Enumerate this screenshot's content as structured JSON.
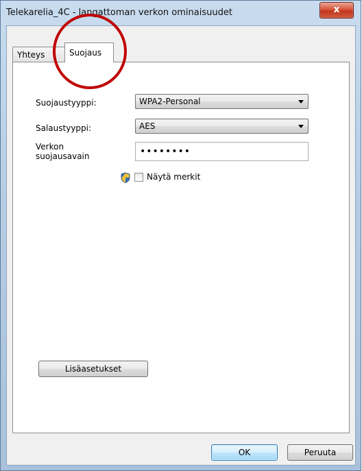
{
  "window": {
    "title": "Telekarelia_4C - langattoman verkon ominaisuudet",
    "close_label": "x"
  },
  "tabs": [
    {
      "label": "Yhteys",
      "active": false
    },
    {
      "label": "Suojaus",
      "active": true
    }
  ],
  "security": {
    "security_type_label": "Suojaustyyppi:",
    "security_type_value": "WPA2-Personal",
    "encryption_type_label": "Salaustyyppi:",
    "encryption_type_value": "AES",
    "key_label_line1": "Verkon",
    "key_label_line2": "suojausavain",
    "key_value": "••••••••",
    "show_chars_label": "Näytä merkit",
    "show_chars_checked": false
  },
  "buttons": {
    "advanced_label": "Lisäasetukset",
    "ok_label": "OK",
    "cancel_label": "Peruuta"
  },
  "colors": {
    "annotation_circle": "#c00000",
    "close_button": "#c1361f"
  },
  "icons": {
    "uac": "shield-icon",
    "dropdown": "chevron-down-icon"
  }
}
